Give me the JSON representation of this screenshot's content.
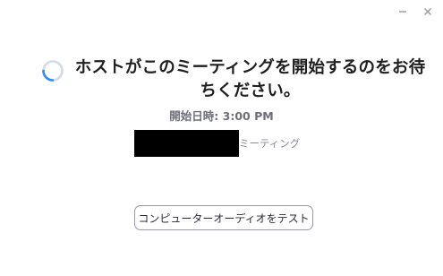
{
  "window": {
    "minimize_label": "−",
    "close_label": "×"
  },
  "main": {
    "title": "ホストがこのミーティングを開始するのをお待ちください。",
    "start_time": "開始日時: 3:00 PM",
    "meeting_suffix": "ミーティング",
    "test_audio_button": "コンピューターオーディオをテスト"
  },
  "icons": {
    "spinner": "loading-spinner-icon"
  },
  "colors": {
    "spinner_track": "#d5dae3",
    "spinner_accent": "#2d8cff",
    "title_text": "#1f1f1f",
    "muted_text": "#6e6e7a",
    "button_border": "#9a9aa6"
  }
}
